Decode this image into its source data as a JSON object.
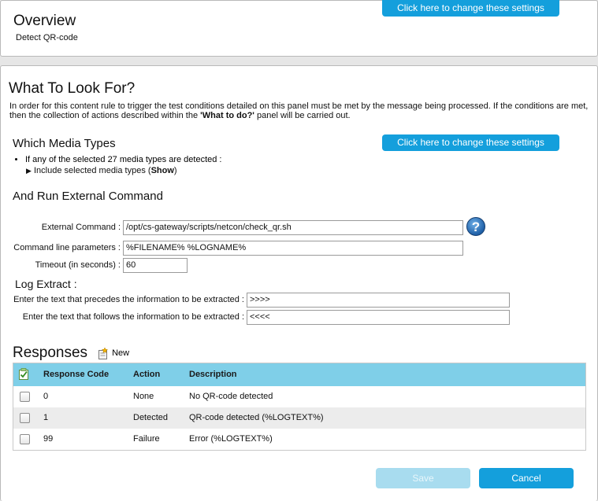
{
  "overview": {
    "title": "Overview",
    "subtitle": "Detect QR-code",
    "change_settings": "Click here to change these settings"
  },
  "look_for": {
    "title": "What To Look For?",
    "description_1": "In order for this content rule to trigger the test conditions detailed on this panel must be met by the message being processed. If the conditions are met,",
    "description_2_pre": "then the collection of actions described within the ",
    "description_2_bold": "'What to do?'",
    "description_2_post": " panel will be carried out."
  },
  "media_types": {
    "title": "Which Media Types",
    "change_settings": "Click here to change these settings",
    "bullet": "If any of the selected 27 media types are detected :",
    "sub_pre": "Include selected media types (",
    "sub_link": "Show",
    "sub_post": ")"
  },
  "external_command": {
    "title": "And Run External Command",
    "command_label": "External Command :",
    "command_value": "/opt/cs-gateway/scripts/netcon/check_qr.sh",
    "params_label": "Command line parameters :",
    "params_value": "%FILENAME% %LOGNAME%",
    "timeout_label": "Timeout (in seconds) :",
    "timeout_value": "60",
    "help_icon": "?"
  },
  "log_extract": {
    "title": "Log Extract :",
    "precedes_label": "Enter the text that precedes the information to be extracted :",
    "precedes_value": ">>>>",
    "follows_label": "Enter the text that follows the information to be extracted :",
    "follows_value": "<<<<"
  },
  "responses": {
    "title": "Responses",
    "new_label": "New",
    "columns": [
      "Response Code",
      "Action",
      "Description"
    ],
    "rows": [
      {
        "code": "0",
        "action": "None",
        "description": "No QR-code detected"
      },
      {
        "code": "1",
        "action": "Detected",
        "description": "QR-code detected (%LOGTEXT%)"
      },
      {
        "code": "99",
        "action": "Failure",
        "description": "Error (%LOGTEXT%)"
      }
    ]
  },
  "footer": {
    "save": "Save",
    "cancel": "Cancel"
  },
  "colors": {
    "accent": "#149fdc",
    "table_header": "#7fcfe8",
    "save_disabled": "#a8dcef"
  },
  "icons": [
    "help-icon",
    "new-item-icon",
    "checklist-icon",
    "checkbox-icon"
  ]
}
